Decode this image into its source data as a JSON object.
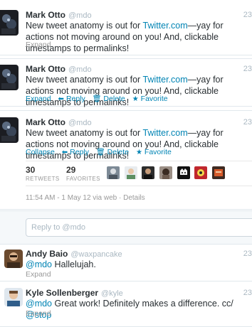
{
  "tweets": [
    {
      "fullname": "Mark Otto",
      "username": "@mdo",
      "timestamp": "23",
      "text_before": "New tweet anatomy is out for ",
      "link": "Twitter.com",
      "text_after": "—yay for actions not moving around on you! And, clickable timestamps to permalinks!",
      "expand_label": "Expand"
    },
    {
      "fullname": "Mark Otto",
      "username": "@mdo",
      "timestamp": "23",
      "text_before": "New tweet anatomy is out for ",
      "link": "Twitter.com",
      "text_after": "—yay for actions not moving around on you! And, clickable timestamps to permalinks!",
      "expand_label": "Expand",
      "reply_label": "Reply",
      "delete_label": "Delete",
      "favorite_label": "Favorite"
    },
    {
      "fullname": "Mark Otto",
      "username": "@mdo",
      "timestamp": "23",
      "text_before": "New tweet anatomy is out for ",
      "link": "Twitter.com",
      "text_after": "—yay for actions not moving around on you! And, clickable timestamps to permalinks!",
      "collapse_label": "Collapse",
      "reply_label": "Reply",
      "delete_label": "Delete",
      "favorite_label": "Favorite",
      "retweets_count": "30",
      "retweets_label": "RETWEETS",
      "favorites_count": "29",
      "favorites_label": "FAVORITES",
      "meta_time": "11:54 AM - 1 May 12 via web · Details"
    }
  ],
  "reply_placeholder": "Reply to @mdo",
  "replies": [
    {
      "fullname": "Andy Baio",
      "username": "@waxpancake",
      "timestamp": "23",
      "mention": "@mdo",
      "text": " Hallelujah.",
      "expand_label": "Expand"
    },
    {
      "fullname": "Kyle Sollenberger",
      "username": "@kyle",
      "timestamp": "23",
      "mention": "@mdo",
      "text": " Great work! Definitely makes a difference. cc/ ",
      "mention2": "@stop",
      "expand_label": "Expand"
    }
  ],
  "colors": {
    "link": "#0084b4",
    "muted": "#999999",
    "border": "#e1e8ed",
    "reply_bg": "#f5f8fa"
  },
  "icons": {
    "reply": "reply-arrow-icon",
    "delete": "trash-icon",
    "favorite": "star-icon"
  }
}
